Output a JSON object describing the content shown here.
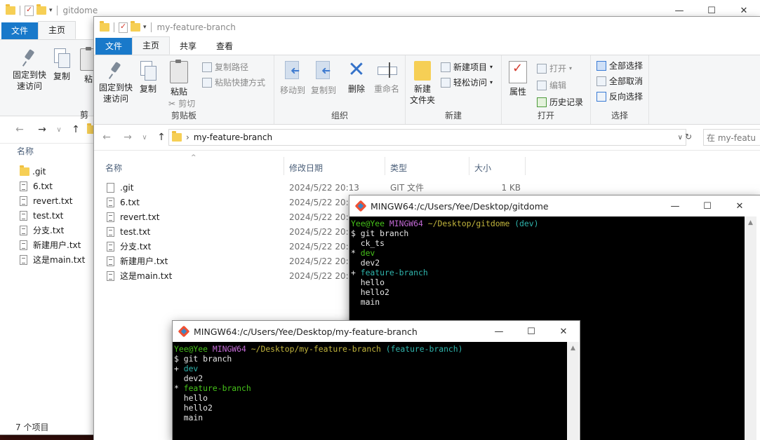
{
  "back_window": {
    "title": "gitdome",
    "tabs": [
      "文件",
      "主页"
    ],
    "pin_label_1": "固定到快",
    "pin_label_2": "速访问",
    "copy_label": "复制",
    "paste_label": "粘",
    "clip_label": "剪",
    "header_name": "名称",
    "files": [
      ".git",
      "6.txt",
      "revert.txt",
      "test.txt",
      "分支.txt",
      "新建用户.txt",
      "这是main.txt"
    ],
    "status": "7 个项目"
  },
  "front_window": {
    "title": "my-feature-branch",
    "tabs": [
      "文件",
      "主页",
      "共享",
      "查看"
    ],
    "ribbon": {
      "pin_1": "固定到快",
      "pin_2": "速访问",
      "copy": "复制",
      "paste": "粘贴",
      "copy_path": "复制路径",
      "paste_shortcut": "粘贴快捷方式",
      "cut": "剪切",
      "group_clipboard": "剪贴板",
      "move_to": "移动到",
      "copy_to": "复制到",
      "delete": "删除",
      "rename": "重命名",
      "group_organize": "组织",
      "new_folder_1": "新建",
      "new_folder_2": "文件夹",
      "new_item": "新建项目",
      "easy_access": "轻松访问",
      "group_new": "新建",
      "properties": "属性",
      "open": "打开",
      "edit": "编辑",
      "history": "历史记录",
      "group_open": "打开",
      "select_all": "全部选择",
      "select_none": "全部取消",
      "invert_selection": "反向选择",
      "group_select": "选择"
    },
    "breadcrumb": "my-feature-branch",
    "search_placeholder": "在 my-featu",
    "columns": [
      "名称",
      "修改日期",
      "类型",
      "大小"
    ],
    "rows": [
      {
        "name": ".git",
        "date": "2024/5/22 20:13",
        "type": "GIT 文件",
        "size": "1 KB"
      },
      {
        "name": "6.txt",
        "date": "2024/5/22 20:1"
      },
      {
        "name": "revert.txt",
        "date": "2024/5/22 20:1"
      },
      {
        "name": "test.txt",
        "date": "2024/5/22 20:1"
      },
      {
        "name": "分支.txt",
        "date": "2024/5/22 20:1"
      },
      {
        "name": "新建用户.txt",
        "date": "2024/5/22 20:1"
      },
      {
        "name": "这是main.txt",
        "date": "2024/5/22 20:1"
      }
    ]
  },
  "terminal_1": {
    "title": "MINGW64:/c/Users/Yee/Desktop/gitdome",
    "prompt_user": "Yee@Yee",
    "prompt_sys": "MINGW64",
    "prompt_path": "~/Desktop/gitdome",
    "prompt_branch": "(dev)",
    "command": "$ git branch",
    "branches": [
      {
        "marker": " ",
        "name": "ck_ts",
        "color": "default"
      },
      {
        "marker": "*",
        "name": "dev",
        "color": "green"
      },
      {
        "marker": " ",
        "name": "dev2",
        "color": "default"
      },
      {
        "marker": "+",
        "name": "feature-branch",
        "color": "cyan"
      },
      {
        "marker": " ",
        "name": "hello",
        "color": "default"
      },
      {
        "marker": " ",
        "name": "hello2",
        "color": "default"
      },
      {
        "marker": " ",
        "name": "main",
        "color": "default"
      }
    ]
  },
  "terminal_2": {
    "title": "MINGW64:/c/Users/Yee/Desktop/my-feature-branch",
    "prompt_user": "Yee@Yee",
    "prompt_sys": "MINGW64",
    "prompt_path": "~/Desktop/my-feature-branch",
    "prompt_branch": "(feature-branch)",
    "command": "$ git branch",
    "branches": [
      {
        "marker": "+",
        "name": "dev",
        "color": "cyan"
      },
      {
        "marker": " ",
        "name": "dev2",
        "color": "default"
      },
      {
        "marker": "*",
        "name": "feature-branch",
        "color": "green"
      },
      {
        "marker": " ",
        "name": "hello",
        "color": "default"
      },
      {
        "marker": " ",
        "name": "hello2",
        "color": "default"
      },
      {
        "marker": " ",
        "name": "main",
        "color": "default"
      }
    ]
  },
  "window_controls": {
    "minimize": "—",
    "maximize": "☐",
    "close": "✕"
  },
  "colors": {
    "accent": "#1979ca",
    "term_green": "#46c21a",
    "term_magenta": "#c36ad6",
    "term_yellow": "#c3b63d",
    "term_cyan": "#2fb5ad"
  }
}
